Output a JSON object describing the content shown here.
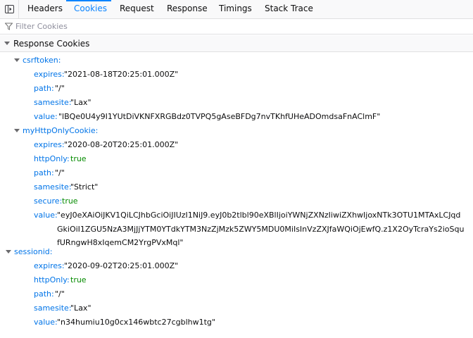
{
  "tabs": [
    "Headers",
    "Cookies",
    "Request",
    "Response",
    "Timings",
    "Stack Trace"
  ],
  "selected_tab": "Cookies",
  "filter": {
    "placeholder": "Filter Cookies",
    "value": ""
  },
  "section": {
    "title": "Response Cookies"
  },
  "cookies": [
    {
      "name": "csrftoken:",
      "props": [
        {
          "key": "expires:",
          "value": "\"2021-08-18T20:25:01.000Z\""
        },
        {
          "key": "path:",
          "value": "\"/\""
        },
        {
          "key": "samesite:",
          "value": "\"Lax\""
        },
        {
          "key": "value:",
          "value": "\"lBQe0U4y9I1YUtDiVKNFXRGBdz0TVPQ5gAseBFDg7nvTKhfUHeADOmdsaFnAClmF\""
        }
      ]
    },
    {
      "name": "myHttpOnlyCookie:",
      "props": [
        {
          "key": "expires:",
          "value": "\"2020-08-20T20:25:01.000Z\""
        },
        {
          "key": "httpOnly:",
          "value": "true"
        },
        {
          "key": "path:",
          "value": "\"/\""
        },
        {
          "key": "samesite:",
          "value": "\"Strict\""
        },
        {
          "key": "secure:",
          "value": "true"
        },
        {
          "key": "value:",
          "value": "\"eyJ0eXAiOiJKV1QiLCJhbGciOiJIUzI1NiJ9.eyJ0b2tlbl90eXBlIjoiYWNjZXNzIiwiZXhwIjoxNTk3OTU1MTAxLCJqdGkiOiI1ZGU5NzA3MjJjYTM0YTdkYTM3NzZjMzk5ZWY5MDU0MiIsInVzZXJfaWQiOjEwfQ.z1X2OyTcraYs2ioSqufURngwH8xIqemCM2YrgPVxMql\""
        }
      ]
    },
    {
      "name": "sessionid:",
      "props": [
        {
          "key": "expires:",
          "value": "\"2020-09-02T20:25:01.000Z\""
        },
        {
          "key": "httpOnly:",
          "value": "true"
        },
        {
          "key": "path:",
          "value": "\"/\""
        },
        {
          "key": "samesite:",
          "value": "\"Lax\""
        },
        {
          "key": "value:",
          "value": "\"n34humiu10g0cx146wbtc27cgblhw1tg\""
        }
      ]
    }
  ],
  "colors": {
    "accent": "#0a84ff",
    "key": "#0074e8",
    "boolean": "#058b00"
  }
}
